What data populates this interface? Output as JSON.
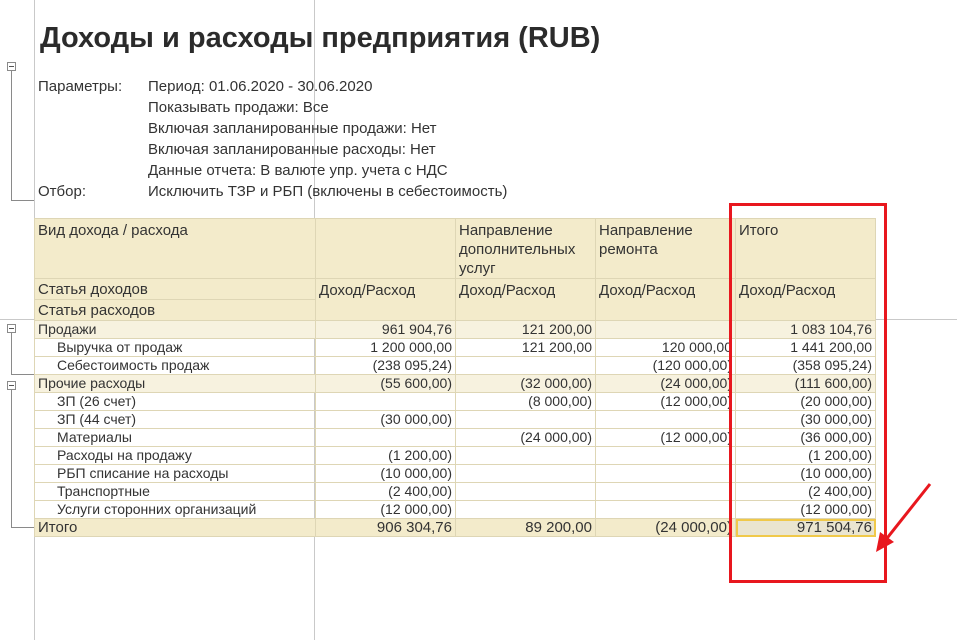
{
  "report": {
    "title": "Доходы и расходы предприятия (RUB)",
    "params_label": "Параметры:",
    "params": [
      "Период: 01.06.2020 - 30.06.2020",
      "Показывать продажи: Все",
      "Включая запланированные продажи: Нет",
      "Включая запланированные расходы: Нет",
      "Данные отчета: В валюте упр. учета с НДС"
    ],
    "filter_label": "Отбор:",
    "filter": "Исключить ТЗР и РБП (включены в себестоимость)"
  },
  "table": {
    "head": {
      "col1": "Вид дохода / расхода",
      "col3": [
        "Направление",
        "дополнительных",
        "услуг"
      ],
      "col4": [
        "Направление",
        "ремонта"
      ],
      "col5": "Итого",
      "income_article": "Статья доходов",
      "expense_article": "Статья расходов",
      "measure": "Доход/Расход"
    },
    "rows": [
      {
        "label": "Продажи",
        "c2": "961 904,76",
        "c3": "121 200,00",
        "c4": "",
        "c5": "1 083 104,76"
      },
      {
        "label": "Выручка от продаж",
        "c2": "1 200 000,00",
        "c3": "121 200,00",
        "c4": "120 000,00",
        "c5": "1 441 200,00"
      },
      {
        "label": "Себестоимость продаж",
        "c2": "(238 095,24)",
        "c3": "",
        "c4": "(120 000,00)",
        "c5": "(358 095,24)"
      },
      {
        "label": "Прочие расходы",
        "c2": "(55 600,00)",
        "c3": "(32 000,00)",
        "c4": "(24 000,00)",
        "c5": "(111 600,00)"
      },
      {
        "label": "ЗП (26 счет)",
        "c2": "",
        "c3": "(8 000,00)",
        "c4": "(12 000,00)",
        "c5": "(20 000,00)"
      },
      {
        "label": "ЗП (44 счет)",
        "c2": "(30 000,00)",
        "c3": "",
        "c4": "",
        "c5": "(30 000,00)"
      },
      {
        "label": "Материалы",
        "c2": "",
        "c3": "(24 000,00)",
        "c4": "(12 000,00)",
        "c5": "(36 000,00)"
      },
      {
        "label": "Расходы на продажу",
        "c2": "(1 200,00)",
        "c3": "",
        "c4": "",
        "c5": "(1 200,00)"
      },
      {
        "label": "РБП списание на расходы",
        "c2": "(10 000,00)",
        "c3": "",
        "c4": "",
        "c5": "(10 000,00)"
      },
      {
        "label": "Транспортные",
        "c2": "(2 400,00)",
        "c3": "",
        "c4": "",
        "c5": "(2 400,00)"
      },
      {
        "label": "Услуги сторонних организаций",
        "c2": "(12 000,00)",
        "c3": "",
        "c4": "",
        "c5": "(12 000,00)"
      }
    ],
    "total": {
      "label": "Итого",
      "c2": "906 304,76",
      "c3": "89 200,00",
      "c4": "(24 000,00)",
      "c5": "971 504,76"
    }
  },
  "annotation": {
    "color": "#e8171e"
  }
}
